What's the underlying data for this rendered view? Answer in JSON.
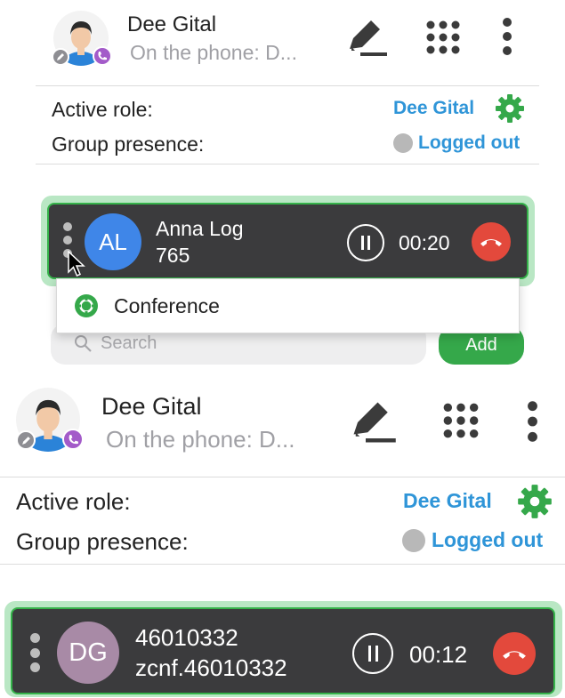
{
  "panels": [
    {
      "user": {
        "name": "Dee Gital",
        "status": "On the phone: D..."
      },
      "icons": {
        "edit": "pencil-icon",
        "dialpad": "dialpad-icon",
        "more": "more-vertical-icon",
        "settings": "gear-icon"
      },
      "info": {
        "active_role_label": "Active role:",
        "active_role_value": "Dee Gital",
        "group_presence_label": "Group presence:",
        "group_presence_value": "Logged out"
      },
      "call": {
        "initials": "AL",
        "avatar_color": "#3f86e8",
        "name": "Anna Log",
        "number": "765",
        "timer": "00:20"
      },
      "menu": {
        "items": [
          {
            "label": "Conference",
            "icon": "conference-icon"
          }
        ]
      },
      "search": {
        "placeholder": "Search",
        "add_label": "Add"
      }
    },
    {
      "user": {
        "name": "Dee Gital",
        "status": "On the phone: D..."
      },
      "icons": {
        "edit": "pencil-icon",
        "dialpad": "dialpad-icon",
        "more": "more-vertical-icon",
        "settings": "gear-icon"
      },
      "info": {
        "active_role_label": "Active role:",
        "active_role_value": "Dee Gital",
        "group_presence_label": "Group presence:",
        "group_presence_value": "Logged out"
      },
      "call": {
        "initials": "DG",
        "avatar_color": "#a88aa6",
        "name": "46010332",
        "number": "zcnf.46010332",
        "timer": "00:12"
      }
    }
  ],
  "colors": {
    "accent_blue": "#2f95d8",
    "accent_green": "#35b24a",
    "card_bg": "#3b3b3d",
    "hangup_red": "#e3493c"
  }
}
